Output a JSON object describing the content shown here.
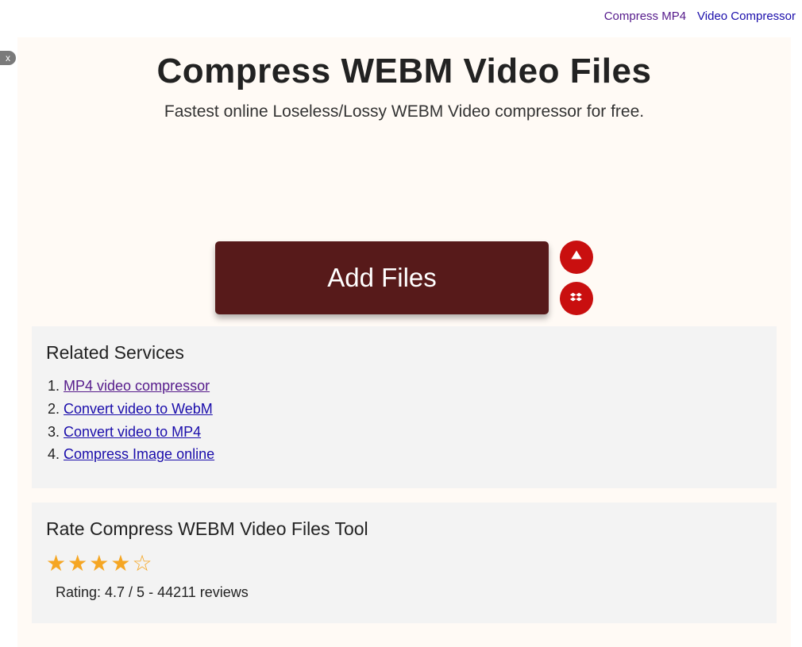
{
  "nav": {
    "link1": "Compress MP4",
    "link2": "Video Compressor"
  },
  "closeBadge": "x",
  "hero": {
    "title": "Compress WEBM Video Files",
    "subtitle": "Fastest online Loseless/Lossy WEBM Video compressor for free."
  },
  "upload": {
    "addFiles": "Add Files"
  },
  "related": {
    "heading": "Related Services",
    "items": [
      {
        "label": "MP4 video compressor",
        "visited": true
      },
      {
        "label": "Convert video to WebM",
        "visited": false
      },
      {
        "label": "Convert video to MP4",
        "visited": false
      },
      {
        "label": "Compress Image online",
        "visited": false
      }
    ]
  },
  "rating": {
    "heading": "Rate Compress WEBM Video Files Tool",
    "value": 4.7,
    "max": 5,
    "reviews": 44211,
    "text": "Rating: 4.7 / 5 - 44211 reviews"
  }
}
